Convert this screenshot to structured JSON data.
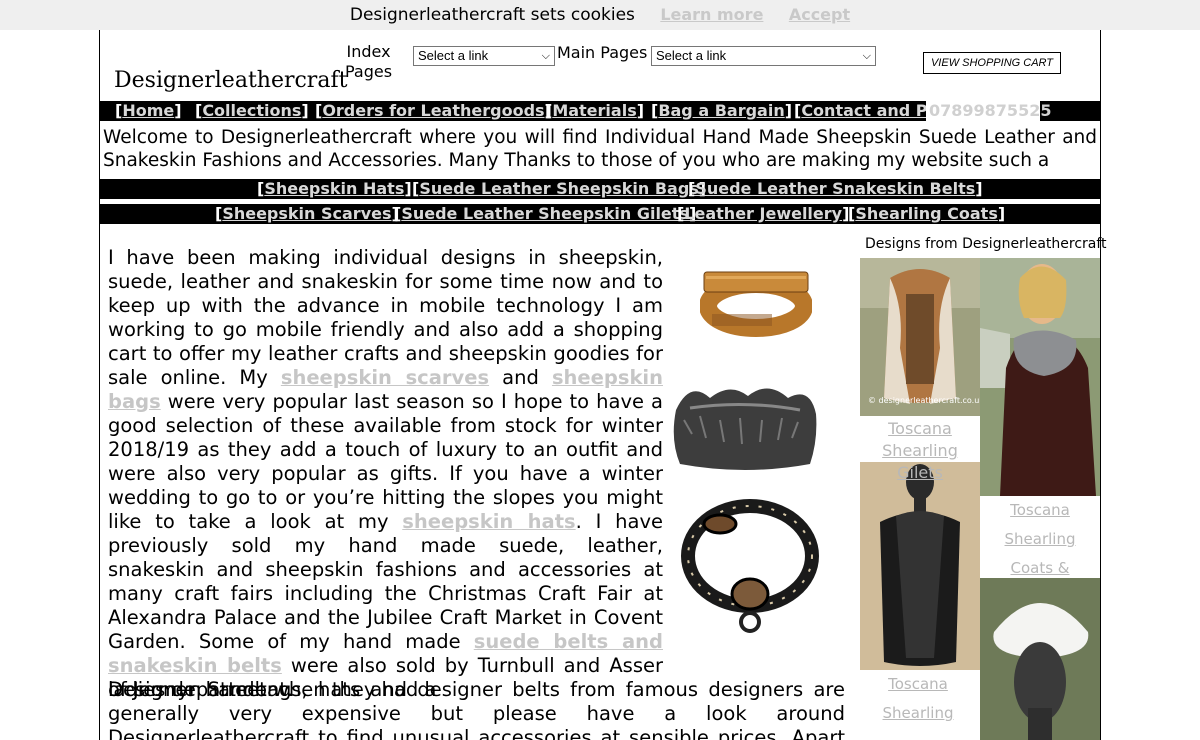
{
  "cookie_bar": {
    "message": "Designerleathercraft sets cookies",
    "learn_more": "Learn more",
    "accept": "Accept"
  },
  "header": {
    "logo": "Designerleathercraft",
    "index_label_1": "Index",
    "index_label_2": "Pages",
    "index_select_value": "Select a link",
    "main_label": "Main Pages",
    "main_select_value": "Select a link",
    "cart_button": "VIEW SHOPPING CART"
  },
  "nav": {
    "home": "Home",
    "collections": "Collections",
    "orders": "Orders for Leathergoods",
    "materials": "Materials",
    "bargain": "Bag a Bargain",
    "contact": "Contact and Pa",
    "phone": "07899875525"
  },
  "welcome": "Welcome to Designerleathercraft where you will find Individual Hand Made Sheepskin Suede Leather and Snakeskin Fashions and Accessories.  Many Thanks to those of you who are making my website such a",
  "nav2": {
    "hats": "Sheepskin Hats",
    "bags": "Suede Leather Sheepskin Bags",
    "belts": "Suede Leather Snakeskin Belts"
  },
  "nav3": {
    "scarves": "Sheepskin Scarves",
    "gilets": "Suede Leather Sheepskin Gilets",
    "jewellery": "Leather Jewellery",
    "coats": "Shearling Coats"
  },
  "body": {
    "p1_a": "I have been making individual designs in sheepskin, suede, leather and snakeskin for some time now and to keep up with the advance in mobile technology I am working to go mobile friendly and also add a shopping cart to offer my leather crafts and sheepskin goodies for sale online. My ",
    "link_scarves": "sheepskin scarves",
    "p1_b": " and ",
    "link_bags": "sheepskin bags",
    "p1_c": " were very popular last season so I hope to have a good selection of these available from stock for winter 2018/19 as they add a touch of luxury to an outfit and were also very popular as gifts. If you have a winter wedding to go to or you’re hitting the slopes you might like to take a look at my ",
    "link_hats": "sheepskin hats",
    "p1_d": ". I have previously sold my hand made suede, leather, snakeskin and sheepskin fashions and accessories at many craft fairs including the Christmas Craft Fair at Alexandra Palace and the Jubilee Craft Market in Covent Garden. Some of my hand made ",
    "link_belts": "suede belts and snakeskin belts",
    "p1_e": " were also sold by Turnbull and Asser of Jermyn Street when they had a",
    "overlap": "ladies department.",
    "p2": "Designer handbags, hats and designer belts from famous designers are generally very expensive but please have a look around Designerleathercraft to find unusual accessories at sensible prices. Apart from my own designs"
  },
  "gallery": {
    "title": "Designs from Designerleathercraft",
    "cap_gilets_1": "Toscana",
    "cap_gilets_2": "Shearling Gilets",
    "cap_coats_1": "Toscana",
    "cap_coats_2": "Shearling",
    "cap_coats_3": "Coats &",
    "cap_scarf_1": "Toscana",
    "cap_scarf_2": "Shearling",
    "watermark": "© designerleathercraft.co.uk"
  }
}
